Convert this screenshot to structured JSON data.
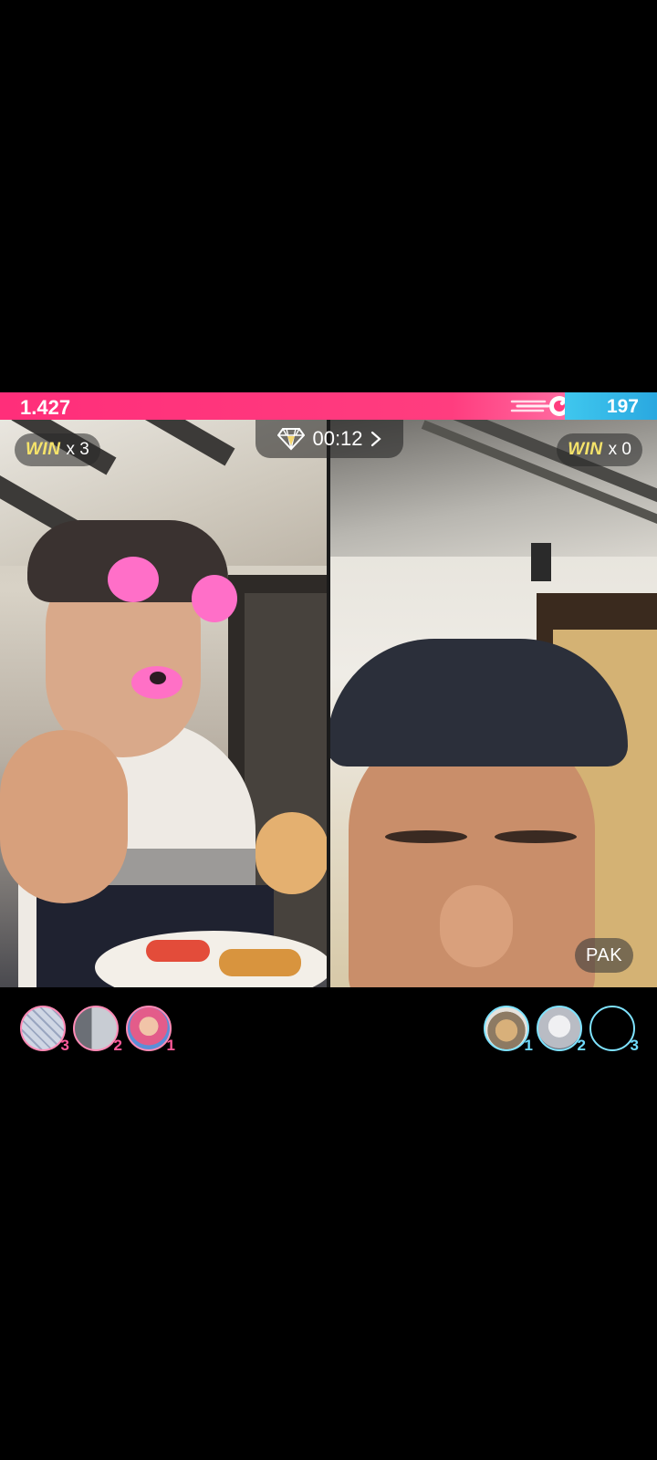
{
  "battle": {
    "left_score": "1.427",
    "right_score": "197",
    "left_share": 0.86,
    "timer": "00:12",
    "colors": {
      "left": "#ff3d7f",
      "right": "#3fc7ee",
      "win_text": "#f5e36a"
    }
  },
  "left_host": {
    "win_label": "WIN",
    "win_count": "x 3"
  },
  "right_host": {
    "win_label": "WIN",
    "win_count": "x 0",
    "name_tag": "PAK"
  },
  "left_gifters": [
    {
      "rank": "3",
      "icon": "avatar-pattern"
    },
    {
      "rank": "2",
      "icon": "avatar-portrait"
    },
    {
      "rank": "1",
      "icon": "avatar-portrait"
    }
  ],
  "right_gifters": [
    {
      "rank": "1",
      "icon": "avatar-cat"
    },
    {
      "rank": "2",
      "icon": "avatar-portrait"
    },
    {
      "rank": "3",
      "icon": "avatar-empty"
    }
  ]
}
